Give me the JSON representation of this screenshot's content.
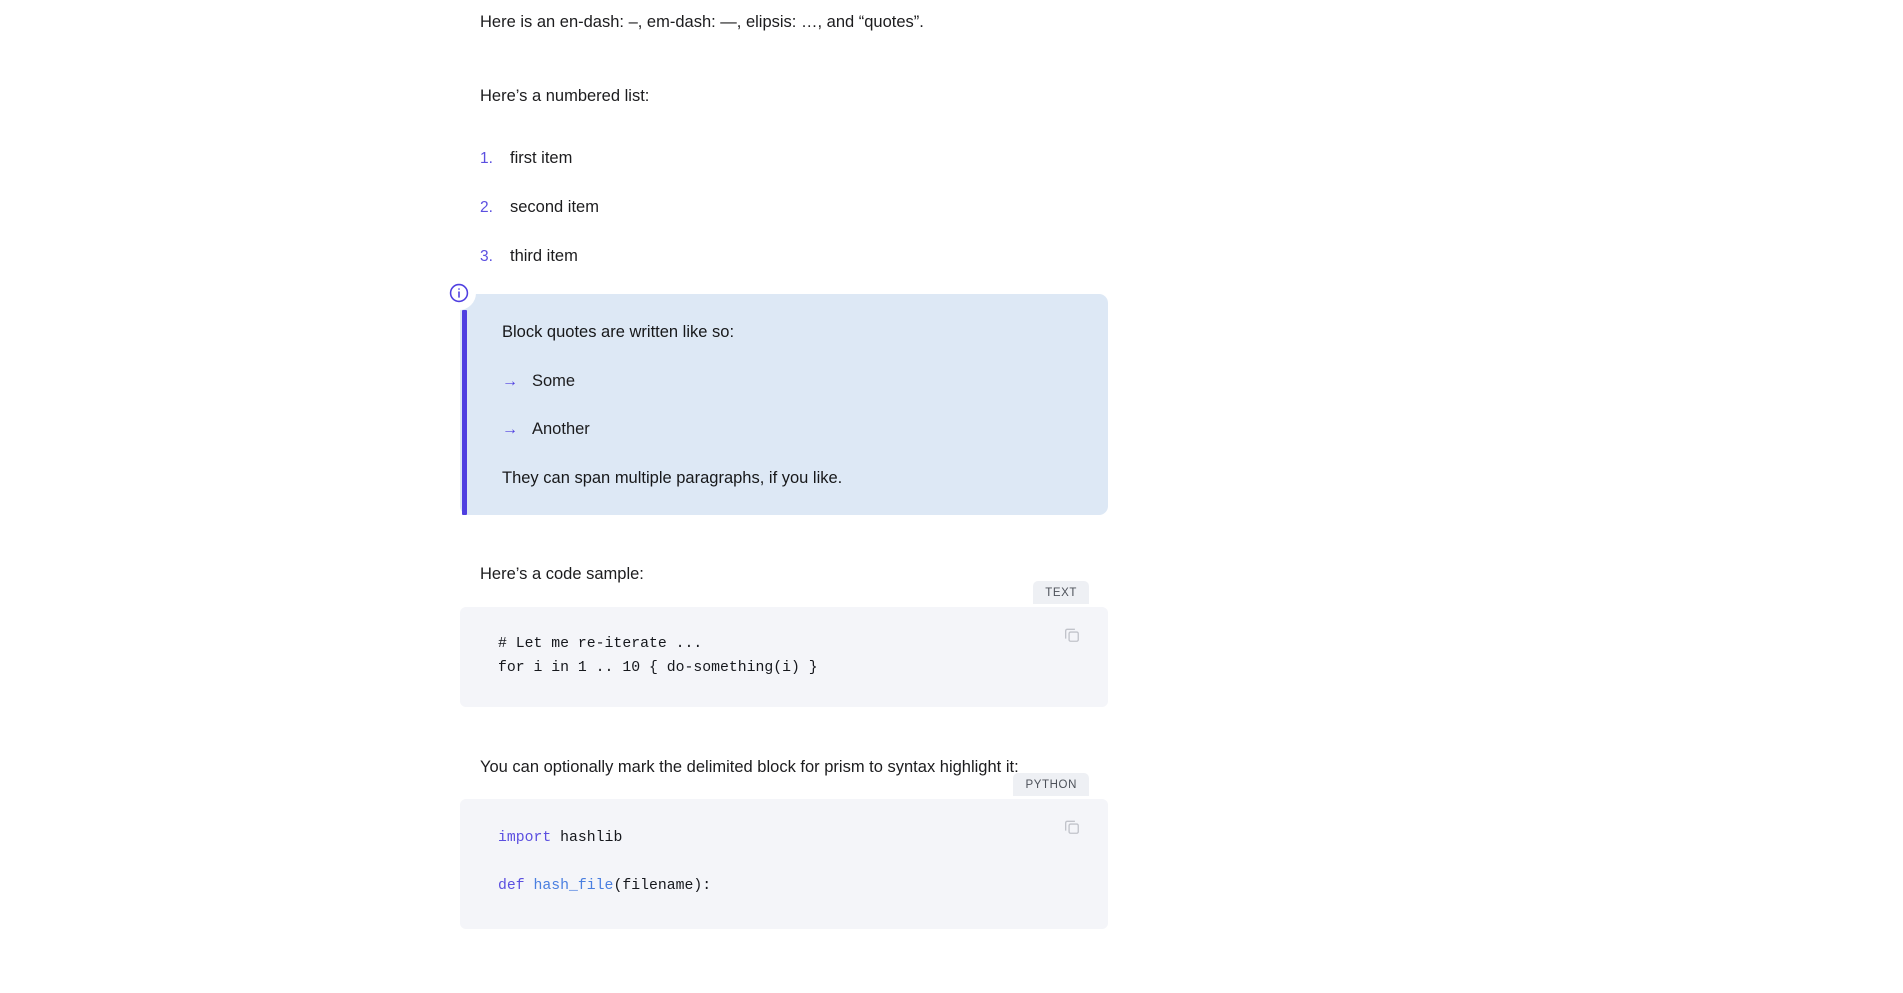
{
  "theme": {
    "accent": "#5b4fe0",
    "callout_bg": "#dde8f5",
    "callout_bar": "#4f3fe0",
    "code_bg": "#f4f5f9",
    "badge_bg": "#eef0f4",
    "text": "#1c1c1e",
    "page_bg": "#ffffff"
  },
  "paragraphs": {
    "endash": "Here is an en-dash: –, em-dash: —, elipsis: …, and “quotes”.",
    "numbered_intro": "Here’s a numbered list:",
    "code_intro": "Here’s a code sample:",
    "prism_intro": "You can optionally mark the delimited block for prism to syntax highlight it:"
  },
  "numbered_list": {
    "items": [
      {
        "marker": "1.",
        "label": "first item"
      },
      {
        "marker": "2.",
        "label": "second item"
      },
      {
        "marker": "3.",
        "label": "third item"
      }
    ]
  },
  "callout": {
    "icon": "info-circle-icon",
    "intro": "Block quotes are written like so:",
    "bullets": [
      {
        "marker": "→",
        "label": "Some"
      },
      {
        "marker": "→",
        "label": "Another"
      }
    ],
    "closing": "They can span multiple paragraphs, if you like."
  },
  "code_blocks": [
    {
      "language_badge": "TEXT",
      "copy_icon": "copy-icon",
      "lines": [
        "# Let me re-iterate ...",
        "for i in 1 .. 10 { do-something(i) }"
      ]
    },
    {
      "language_badge": "PYTHON",
      "copy_icon": "copy-icon",
      "tokens": {
        "import_kw": "import",
        "import_mod": " hashlib",
        "def_kw": "def",
        "def_fn": " hash_file",
        "def_args": "(filename):"
      }
    }
  ]
}
